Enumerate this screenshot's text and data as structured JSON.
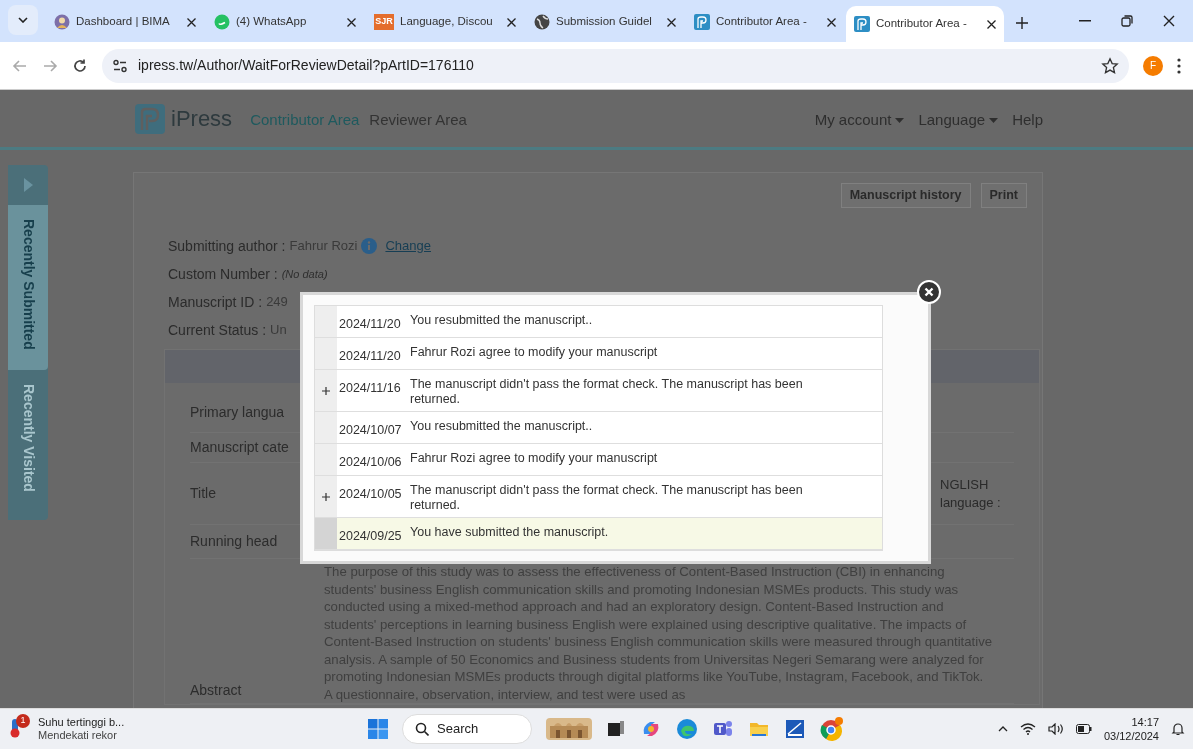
{
  "browser": {
    "tabs": [
      {
        "title": "Dashboard | BIMA",
        "kind": "avatar",
        "selected": false
      },
      {
        "title": "(4) WhatsApp",
        "kind": "chat",
        "selected": false
      },
      {
        "title": "Language, Discou",
        "kind": "badge",
        "icon_text": "SJR",
        "selected": false
      },
      {
        "title": "Submission Guidel",
        "kind": "globe",
        "selected": false
      },
      {
        "title": "Contributor Area -",
        "kind": "site",
        "selected": false
      },
      {
        "title": "Contributor Area -",
        "kind": "site",
        "selected": true
      }
    ],
    "address": "ipress.tw/Author/WaitForReviewDetail?pArtID=176110",
    "profile_initial": "F"
  },
  "site": {
    "brand": "iPress",
    "nav": [
      {
        "label": "Contributor Area",
        "selected": true
      },
      {
        "label": "Reviewer Area",
        "selected": false
      }
    ],
    "account_menu": [
      {
        "label": "My account",
        "dropdown": true
      },
      {
        "label": "Language",
        "dropdown": true
      },
      {
        "label": "Help",
        "dropdown": false
      }
    ],
    "sidebar_tabs": [
      {
        "label": "Recently Submitted",
        "selected": true
      },
      {
        "label": "Recently Visited",
        "selected": false
      }
    ],
    "buttons": [
      "Manuscript history",
      "Print"
    ],
    "fields": [
      {
        "label": "Submitting author :",
        "value": "Fahrur Rozi",
        "info": true,
        "link": "Change"
      },
      {
        "label": "Custom Number :",
        "value": "(No data)",
        "empty": true
      },
      {
        "label": "Manuscript ID :",
        "value": "249"
      },
      {
        "label": "Current Status :",
        "value": "Un"
      }
    ],
    "details": {
      "rows": [
        {
          "label": "Primary langua"
        },
        {
          "label": "Manuscript cate"
        },
        {
          "label": "Title",
          "value_lines": [
            "NGLISH",
            "language :"
          ]
        },
        {
          "label": "Running head"
        },
        {
          "label": "Abstract",
          "value": "The purpose of this study was to assess the effectiveness of Content-Based Instruction (CBI) in enhancing students' business English communication skills and promoting Indonesian MSMEs products. This study was conducted using a mixed-method approach and had an exploratory design. Content-Based Instruction and students' perceptions in learning business English were explained using descriptive qualitative. The impacts of Content-Based Instruction on students' business English communication skills were measured through quantitative analysis. A sample of 50 Economics and Business students from Universitas Negeri Semarang were analyzed for promoting Indonesian MSMEs products through digital platforms like YouTube, Instagram, Facebook, and TikTok. A questionnaire, observation, interview, and test were used as"
        }
      ]
    }
  },
  "history_modal": {
    "rows": [
      {
        "date": "2024/11/20",
        "message": "You resubmitted the manuscript..",
        "expandable": false,
        "highlighted": false
      },
      {
        "date": "2024/11/20",
        "message": "Fahrur Rozi agree to modify your manuscript",
        "expandable": false,
        "highlighted": false
      },
      {
        "date": "2024/11/16",
        "message": "The manuscript didn't pass the format check. The manuscript has been returned.",
        "expandable": true,
        "highlighted": false
      },
      {
        "date": "2024/10/07",
        "message": "You resubmitted the manuscript..",
        "expandable": false,
        "highlighted": false
      },
      {
        "date": "2024/10/06",
        "message": "Fahrur Rozi agree to modify your manuscript",
        "expandable": false,
        "highlighted": false
      },
      {
        "date": "2024/10/05",
        "message": "The manuscript didn't pass the format check. The manuscript has been returned.",
        "expandable": true,
        "highlighted": false
      },
      {
        "date": "2024/09/25",
        "message": "You have submitted the manuscript.",
        "expandable": false,
        "highlighted": true
      }
    ]
  },
  "taskbar": {
    "weather": {
      "badge": "1",
      "title": "Suhu tertinggi b...",
      "subtitle": "Mendekati rekor"
    },
    "search": "Search",
    "time": "14:17",
    "date": "03/12/2024"
  }
}
